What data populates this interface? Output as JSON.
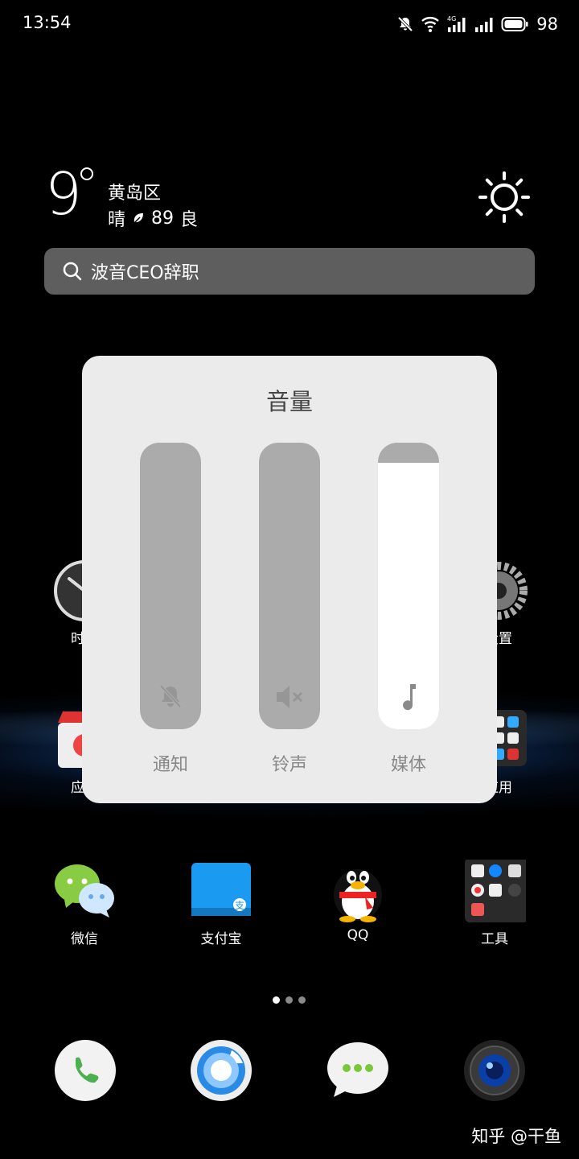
{
  "status_bar": {
    "time": "13:54",
    "battery": "98",
    "network": "4G",
    "icons": [
      "mute-bell-icon",
      "wifi-icon",
      "signal-4g-icon",
      "signal-icon",
      "battery-icon"
    ]
  },
  "weather": {
    "temperature": "9",
    "district": "黄岛区",
    "condition": "晴",
    "aqi": "89",
    "aqi_level": "良",
    "icon": "sun-icon"
  },
  "search": {
    "query": "波音CEO辞职"
  },
  "home_apps": {
    "row1": [
      "时钟",
      "",
      "",
      "设置"
    ],
    "row2": [
      "应用",
      "",
      "",
      "应用"
    ],
    "row3": [
      "微信",
      "支付宝",
      "QQ",
      "工具"
    ]
  },
  "volume_panel": {
    "title": "音量",
    "sliders": [
      {
        "label": "通知",
        "icon": "bell-off-icon",
        "level": 0.0
      },
      {
        "label": "铃声",
        "icon": "speaker-mute-icon",
        "level": 0.0
      },
      {
        "label": "媒体",
        "icon": "music-note-icon",
        "level": 0.93
      }
    ]
  },
  "page_indicator": {
    "count": 3,
    "active": 0
  },
  "dock": [
    "phone-icon",
    "browser-icon",
    "messages-icon",
    "camera-icon"
  ],
  "watermark": "知乎 @干鱼",
  "colors": {
    "panel": "#ebebeb",
    "slider_track": "#ababab",
    "slider_fill": "#ffffff"
  }
}
